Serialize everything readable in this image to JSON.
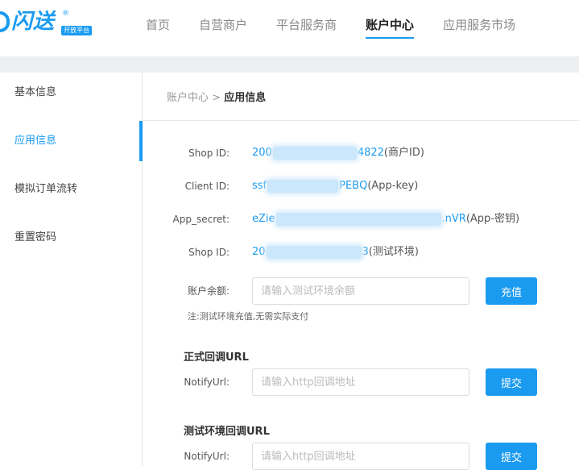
{
  "brand": {
    "name": "闪送",
    "reg_mark": "®",
    "badge": "开放平台"
  },
  "nav": {
    "items": [
      {
        "label": "首页",
        "active": false
      },
      {
        "label": "自营商户",
        "active": false
      },
      {
        "label": "平台服务商",
        "active": false
      },
      {
        "label": "账户中心",
        "active": true
      },
      {
        "label": "应用服务市场",
        "active": false
      }
    ]
  },
  "sidebar": {
    "items": [
      {
        "label": "基本信息",
        "active": false
      },
      {
        "label": "应用信息",
        "active": true
      },
      {
        "label": "模拟订单流转",
        "active": false
      },
      {
        "label": "重置密码",
        "active": false
      }
    ]
  },
  "breadcrumb": {
    "parent": "账户中心",
    "separator": ">",
    "current": "应用信息"
  },
  "info": {
    "shop_id": {
      "label": "Shop ID:",
      "value_start": "200",
      "value_end": "4822",
      "note": "(商户ID)"
    },
    "client_id": {
      "label": "Client ID:",
      "value_start": "ssf",
      "value_end": "PEBQ",
      "note": "(App-key)"
    },
    "app_secret": {
      "label": "App_secret:",
      "value_start": "eZie",
      "value_end": ".nVR",
      "note": "(App-密钥)"
    },
    "test_shop_id": {
      "label": "Shop ID:",
      "value_start": "20",
      "value_end": "3",
      "note": "(测试环境)"
    }
  },
  "balance": {
    "label": "账户余额:",
    "placeholder": "请输入测试环境余额",
    "value": "",
    "button_label": "充值",
    "hint": "注:测试环境充值,无需实际支付"
  },
  "prod_callback": {
    "title": "正式回调URL",
    "label": "NotifyUrl:",
    "placeholder": "请输入http回调地址",
    "value": "",
    "button_label": "提交"
  },
  "test_callback": {
    "title": "测试环境回调URL",
    "label": "NotifyUrl:",
    "placeholder": "请输入http回调地址",
    "value": "",
    "button_label": "提交"
  },
  "colors": {
    "accent": "#1a9bf0",
    "band": "#eeeff2",
    "masked_value": "#c9e6fb"
  }
}
